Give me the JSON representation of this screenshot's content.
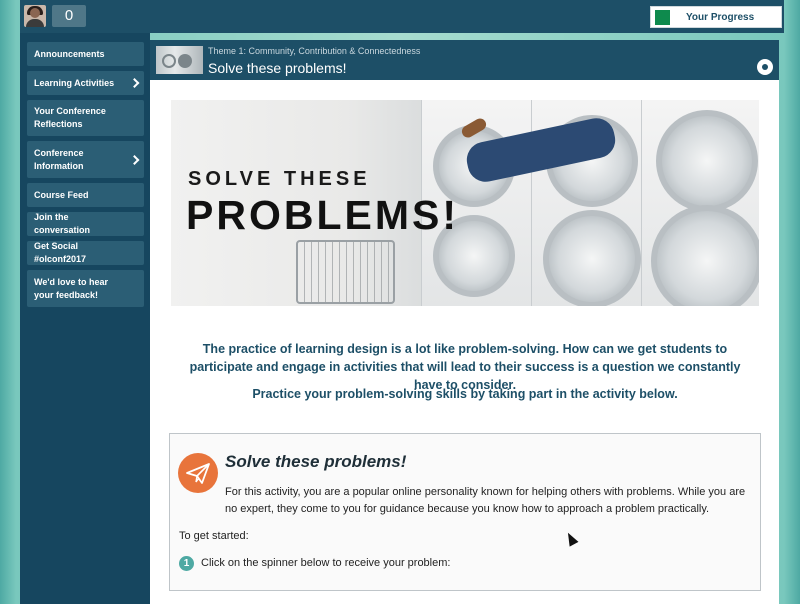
{
  "topbar": {
    "points": "0",
    "progress_label": "Your Progress",
    "progress_color": "#0e8a4d"
  },
  "sidebar": {
    "items": [
      {
        "label": "Announcements",
        "chevron": false
      },
      {
        "label": "Learning Activities",
        "chevron": true
      },
      {
        "label": "Your Conference Reflections",
        "chevron": false
      },
      {
        "label": "Conference Information",
        "chevron": true
      },
      {
        "label": "Course Feed",
        "chevron": false
      },
      {
        "label": "Join the conversation",
        "chevron": false
      },
      {
        "label": "Get Social #olconf2017",
        "chevron": false
      },
      {
        "label": "We'd love to hear your feedback!",
        "chevron": false
      }
    ]
  },
  "header": {
    "theme": "Theme 1: Community, Contribution & Connectedness",
    "title": "Solve these problems!"
  },
  "hero": {
    "subtitle": "SOLVE THESE",
    "main": "PROBLEMS!"
  },
  "intro": {
    "text": "The practice of learning design is a lot like problem-solving. How can we get students to participate and engage in activities that will lead to their success is a question we constantly have to consider.",
    "cta": "Practice your problem-solving skills by taking part in the activity below."
  },
  "activity": {
    "icon": "paper-plane-icon",
    "title": "Solve these problems!",
    "description": "For this activity, you are a popular online personality known for helping others with problems. While you are no expert, they come to you for guidance because you know how to approach a problem practically.",
    "get_started": "To get started:",
    "steps": [
      {
        "num": "1",
        "text": "Click on the spinner below to receive your problem:"
      }
    ]
  },
  "colors": {
    "primary": "#1d4f67",
    "sidebar": "#16465f",
    "accent": "#4ea9a3",
    "icon_orange": "#e8743b"
  }
}
